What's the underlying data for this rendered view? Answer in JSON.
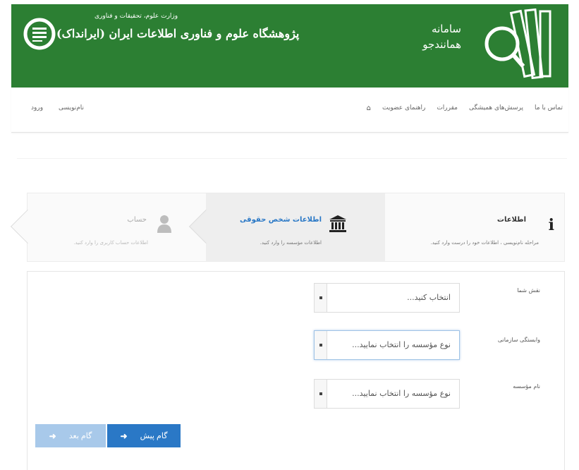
{
  "header": {
    "system_title_line1": "سامانه",
    "system_title_line2": "همانندجو",
    "org_small": "وزارت علوم، تحقیقات و فناوری",
    "org_name": "پژوهشگاه علوم و فناوری اطلاعات ایران (ایرانداک)",
    "brand_color": "#2c7f33"
  },
  "nav": {
    "home_icon": "home-icon",
    "items": [
      "راهنمای عضویت",
      "مقررات",
      "پرسش‌های همیشگی",
      "تماس با ما"
    ],
    "register": "نام‌نویسی",
    "login": "ورود"
  },
  "steps": [
    {
      "title": "اطلاعات",
      "desc": "مراحله نام‌نویسی ، اطلاعات خود را درست وارد کنید.",
      "icon": "info-icon"
    },
    {
      "title": "اطلاعات شخص حقوقی",
      "desc": "اطلاعات مؤسسه را وارد کنید.",
      "icon": "institution-icon"
    },
    {
      "title": "حساب",
      "desc": "اطلاعات حساب کاربری را وارد کنید.",
      "icon": "user-icon"
    }
  ],
  "form": {
    "role_label": "نقش شما",
    "role_value": "انتخاب کنید...",
    "affiliation_label": "وابستگی سازمانی",
    "affiliation_value": "نوع مؤسسه را انتخاب نمایید...",
    "institution_label": "نام مؤسسه",
    "institution_value": "نوع مؤسسه را انتخاب نمایید..."
  },
  "buttons": {
    "prev": "گام پیش",
    "next": "گام بعد",
    "primary_color": "#2a78c6"
  }
}
